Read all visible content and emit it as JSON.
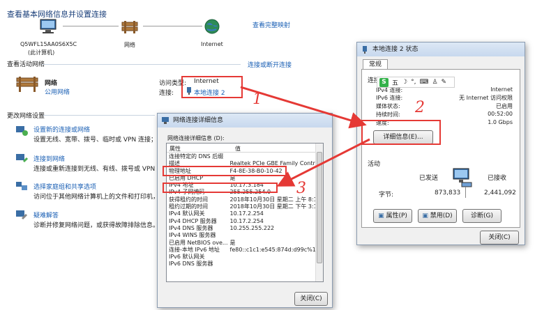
{
  "page_title": "查看基本网络信息并设置连接",
  "view_full_map": "查看完整映射",
  "map": {
    "computer": "Q5WFL15AA0S6X5C",
    "computer_sub": "(此计算机)",
    "network": "网络",
    "internet": "Internet"
  },
  "active_networks": {
    "heading": "查看活动网络",
    "connect_link": "连接或断开连接",
    "network_name": "网络",
    "network_type": "公用网络",
    "access_type_label": "访问类型:",
    "access_type_value": "Internet",
    "connections_label": "连接:",
    "connection_value": "本地连接 2"
  },
  "change_settings": {
    "heading": "更改网络设置",
    "items": [
      {
        "title": "设置新的连接或网络",
        "desc": "设置无线、宽带、拨号、临时或 VPN 连接；或设"
      },
      {
        "title": "连接到网络",
        "desc": "连接或重新连接到无线、有线、拨号或 VPN 网络"
      },
      {
        "title": "选择家庭组和共享选项",
        "desc": "访问位于其他网络计算机上的文件和打印机，或"
      },
      {
        "title": "疑难解答",
        "desc": "诊断并修复网络问题，或获得故障排除信息。"
      }
    ]
  },
  "details_dialog": {
    "title": "网络连接详细信息",
    "group_label": "网络连接详细信息 (D):",
    "col_property": "属性",
    "col_value": "值",
    "rows": [
      [
        "连接特定的 DNS 后缀",
        ""
      ],
      [
        "描述",
        "Realtek PCIe GBE Family Contro"
      ],
      [
        "物理地址",
        "F4-8E-38-B0-10-42"
      ],
      [
        "已启用 DHCP",
        "是"
      ],
      [
        "IPv4 地址",
        "10.17.3.184"
      ],
      [
        "IPv4 子网掩码",
        "255.255.254.0"
      ],
      [
        "获得租约的时间",
        "2018年10月30日 星期二 上午 8:1"
      ],
      [
        "租约过期的时间",
        "2018年10月30日 星期二 下午 3:1"
      ],
      [
        "IPv4 默认网关",
        "10.17.2.254"
      ],
      [
        "IPv4 DHCP 服务器",
        "10.17.2.254"
      ],
      [
        "IPv4 DNS 服务器",
        "10.255.255.222"
      ],
      [
        "IPv4 WINS 服务器",
        ""
      ],
      [
        "已启用 NetBIOS ove...",
        "是"
      ],
      [
        "连接-本地 IPv6 地址",
        "fe80::c1c1:e545:874d:d99c%12"
      ],
      [
        "IPv6 默认网关",
        ""
      ],
      [
        "IPv6 DNS 服务器",
        ""
      ]
    ],
    "close_button": "关闭(C)"
  },
  "status_dialog": {
    "title": "本地连接 2 状态",
    "tab": "常规",
    "connection_group": "连接",
    "rows": [
      [
        "IPv4 连接:",
        "Internet"
      ],
      [
        "IPv6 连接:",
        "无 Internet 访问权限"
      ],
      [
        "媒体状态:",
        "已启用"
      ],
      [
        "持续时间:",
        "00:52:00"
      ],
      [
        "速度:",
        "1.0 Gbps"
      ]
    ],
    "details_button": "详细信息(E)...",
    "activity_group": "活动",
    "sent_label": "已发送",
    "received_label": "已接收",
    "bytes_label": "字节:",
    "bytes_sent": "873,833",
    "bytes_received": "2,441,092",
    "properties_button": "属性(P)",
    "disable_button": "禁用(D)",
    "diagnose_button": "诊断(G)",
    "close_button": "关闭(C)"
  },
  "annotations": {
    "n1": "1",
    "n2": "2",
    "n3": "3"
  },
  "ime_toolbar": {
    "logo": "S",
    "mode": "五"
  },
  "colors": {
    "link": "#1a5fb4",
    "annotation": "#e53935"
  }
}
